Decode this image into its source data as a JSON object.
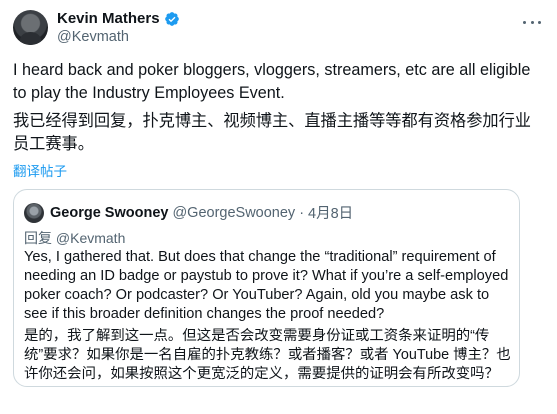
{
  "author": {
    "display_name": "Kevin Mathers",
    "handle": "@Kevmath",
    "avatar_icon": "user-avatar",
    "verified_icon": "verified-badge-icon",
    "verified_color": "#1d9bf0"
  },
  "more_icon": "more-horizontal-icon",
  "tweet": {
    "text_en": "I heard back and poker bloggers, vloggers, streamers, etc are all eligible to play the Industry Employees Event.",
    "text_cn": "我已经得到回复，扑克博主、视频博主、直播主播等等都有资格参加行业员工赛事。",
    "translate_label": "翻译帖子"
  },
  "quote": {
    "display_name": "George Swooney",
    "handle": "@GeorgeSwooney",
    "separator": "·",
    "date": "4月8日",
    "reply_prefix": "回复",
    "reply_handle": "@Kevmath",
    "text_en": "Yes, I gathered that. But does that change the “traditional” requirement of needing an ID badge or paystub to prove it? What if you’re a self-employed poker coach? Or podcaster? Or YouTuber? Again,  old you maybe ask to see if this broader definition changes the proof needed?",
    "text_cn": "是的，我了解到这一点。但这是否会改变需要身份证或工资条来证明的“传统”要求？如果你是一名自雇的扑克教练？或者播客？或者 YouTube 博主？也许你还会问，如果按照这个更宽泛的定义，需要提供的证明会有所改变吗？"
  },
  "colors": {
    "link": "#1d9bf0",
    "secondary_text": "#536471",
    "border": "#cfd9de",
    "primary_text": "#0f1419"
  }
}
